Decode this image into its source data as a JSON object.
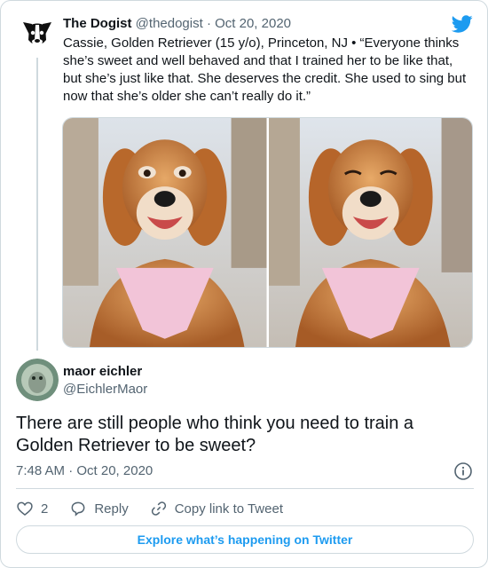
{
  "parent_tweet": {
    "author_name": "The Dogist",
    "handle": "@thedogist",
    "separator": "·",
    "date": "Oct 20, 2020",
    "text": "Cassie, Golden Retriever (15 y/o), Princeton, NJ • “Everyone thinks she’s sweet and well behaved and that I trained her to be like that, but she’s just like that. She deserves the credit. She used to sing but now that she’s older she can’t really do it.”",
    "avatar_icon": "dog-face-icon",
    "photos": [
      "golden-retriever-smiling-photo",
      "golden-retriever-eyes-closed-photo"
    ]
  },
  "brand": {
    "icon": "twitter-bird-icon",
    "color": "#1d9bf0"
  },
  "reply_tweet": {
    "author_name": "maor eichler",
    "handle": "@EichlerMaor",
    "text": "There are still people who think you need to train a Golden Retriever to be sweet?",
    "timestamp": "7:48 AM · Oct 20, 2020"
  },
  "actions": {
    "like_count": "2",
    "reply_label": "Reply",
    "copy_link_label": "Copy link to Tweet"
  },
  "explore_button": {
    "label": "Explore what’s happening on Twitter"
  }
}
